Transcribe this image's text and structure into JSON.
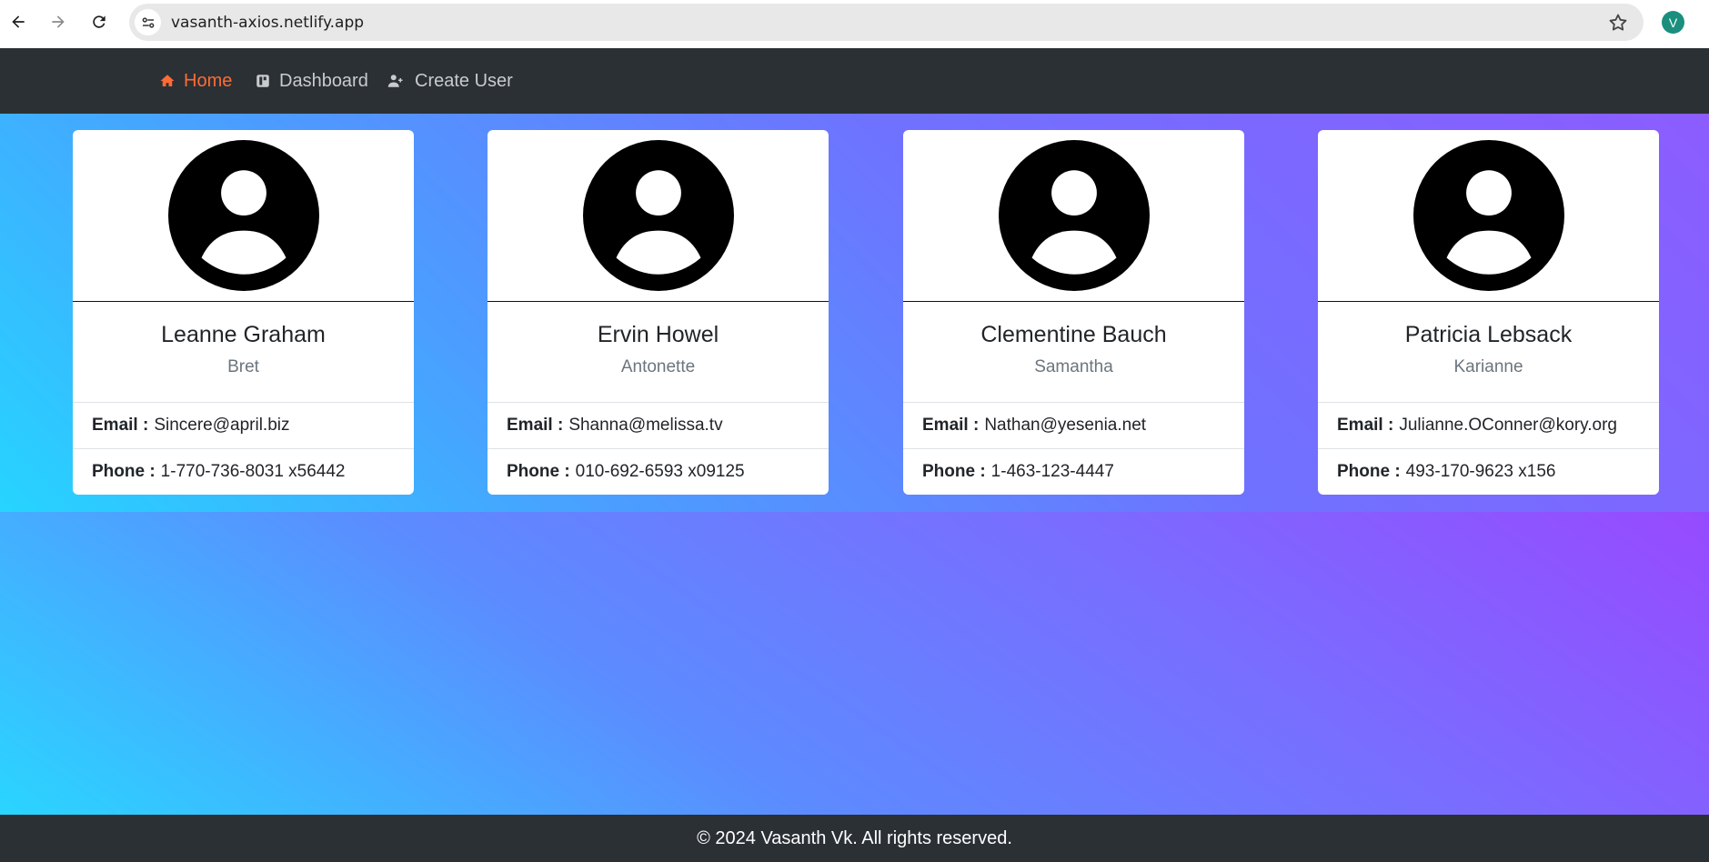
{
  "browser": {
    "url": "vasanth-axios.netlify.app",
    "profile_initial": "V"
  },
  "nav": {
    "items": [
      {
        "label": "Home",
        "icon": "home-icon",
        "active": true
      },
      {
        "label": "Dashboard",
        "icon": "dashboard-icon",
        "active": false
      },
      {
        "label": "Create User",
        "icon": "user-plus-icon",
        "active": false
      }
    ]
  },
  "users": [
    {
      "name": "Leanne Graham",
      "username": "Bret",
      "email_label": "Email :",
      "email": "Sincere@april.biz",
      "phone_label": "Phone :",
      "phone": "1-770-736-8031 x56442"
    },
    {
      "name": "Ervin Howel",
      "username": "Antonette",
      "email_label": "Email :",
      "email": "Shanna@melissa.tv",
      "phone_label": "Phone :",
      "phone": "010-692-6593 x09125"
    },
    {
      "name": "Clementine Bauch",
      "username": "Samantha",
      "email_label": "Email :",
      "email": "Nathan@yesenia.net",
      "phone_label": "Phone :",
      "phone": "1-463-123-4447"
    },
    {
      "name": "Patricia Lebsack",
      "username": "Karianne",
      "email_label": "Email :",
      "email": "Julianne.OConner@kory.org",
      "phone_label": "Phone :",
      "phone": "493-170-9623 x156"
    }
  ],
  "footer": {
    "text": "© 2024 Vasanth Vk. All rights reserved."
  },
  "colors": {
    "accent": "#ff6b35",
    "nav_bg": "#2b3035"
  }
}
